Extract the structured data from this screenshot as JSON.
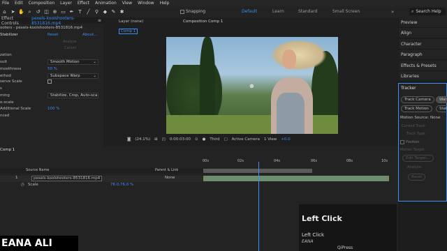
{
  "menu": [
    "File",
    "Edit",
    "Composition",
    "Layer",
    "Effect",
    "Animation",
    "View",
    "Window",
    "Help"
  ],
  "toolbar": {
    "snapping": "Snapping",
    "workspaces": [
      "Default",
      "Learn",
      "Standard",
      "Small Screen"
    ],
    "search": "Search Help"
  },
  "effect_controls": {
    "tab": "Effect Controls",
    "file": "pexels-kooIshooters-8531816.mp4",
    "breadcrumb": "ooters - pexels-kooIshooters-8531816.mp4",
    "effect": "Stabilizer",
    "reset": "Reset",
    "about": "About...",
    "analyze": "Analyze",
    "cancel": "Cancel",
    "rows": [
      {
        "label": "zation"
      },
      {
        "label": "sult",
        "value": "Smooth Motion"
      },
      {
        "label": "moothness",
        "value": "50 %"
      },
      {
        "label": "ethod",
        "value": "Subspace Warp"
      },
      {
        "label": "serve Scale"
      },
      {
        "label": "s"
      },
      {
        "label": "ming",
        "value": "Stabilize, Crop, Auto-sca"
      },
      {
        "label": "o-scale"
      },
      {
        "label": "Additional Scale",
        "value": "100 %"
      },
      {
        "label": "nced"
      }
    ]
  },
  "layer_tab": "Layer (none)",
  "comp_tab": "Composition Comp 1",
  "comp_sub": "Comp 1",
  "viewer_bar": {
    "zoom": "(24.1%)",
    "time": "0:00:03:00",
    "quality": "Third",
    "camera": "Active Camera",
    "views": "1 View",
    "exposure": "+0.0"
  },
  "right_panel": [
    "Preview",
    "Align",
    "Character",
    "Paragraph",
    "Effects & Presets",
    "Libraries"
  ],
  "tracker": {
    "title": "Tracker",
    "buttons": [
      "Track Camera",
      "Warp",
      "Track Motion",
      "Stabi"
    ],
    "motion_source_label": "Motion Source:",
    "motion_source": "None",
    "current_track": "Current Track:",
    "track_type": "Track Type:",
    "position": "Position",
    "motion_target": "Motion Target:",
    "edit_target": "Edit Target...",
    "analyze": "Analyze:",
    "reset": "Reset"
  },
  "timeline": {
    "tab": "Comp 1",
    "cols": [
      "Source Name",
      "Parent & Link"
    ],
    "layer_num": "1",
    "layer_name": "pexels-koolshooters-8531816.mp4",
    "parent": "None",
    "prop": "Scale",
    "scale": "76.0,76.0 %",
    "ruler": [
      "00s",
      "02s",
      "04s",
      "06s",
      "08s",
      "10s"
    ]
  },
  "overlay": {
    "title": "Left Click",
    "line1": "Left Click",
    "line2": "EANA",
    "footer": "QiPress"
  },
  "caption": "EANA ALI"
}
